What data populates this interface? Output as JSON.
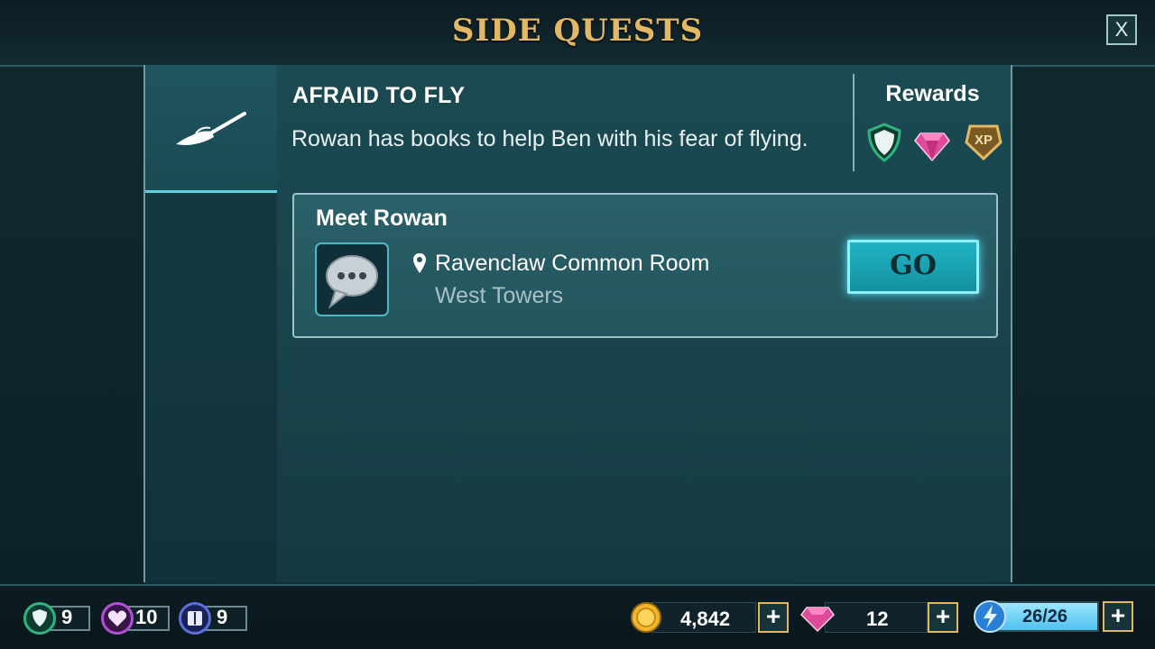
{
  "header": {
    "title": "SIDE QUESTS",
    "close_label": "X"
  },
  "quest": {
    "title": "AFRAID TO FLY",
    "description": "Rowan has books to help Ben with his fear of flying.",
    "rewards_label": "Rewards",
    "reward_icons": [
      "shield-icon",
      "gem-icon",
      "xp-badge-icon"
    ],
    "xp_label": "XP"
  },
  "objective": {
    "title": "Meet Rowan",
    "location": "Ravenclaw Common Room",
    "sublocation": "West Towers",
    "go_label": "GO"
  },
  "stats": {
    "courage": "9",
    "empathy": "10",
    "knowledge": "9"
  },
  "currency": {
    "coins": "4,842",
    "gems": "12",
    "energy": "26/26",
    "plus_label": "+"
  },
  "colors": {
    "title_gold": "#e2b765",
    "go_button": "#20b3c4",
    "courage": "#2fb37f",
    "empathy": "#b34fd6",
    "knowledge": "#5a6fd8"
  }
}
